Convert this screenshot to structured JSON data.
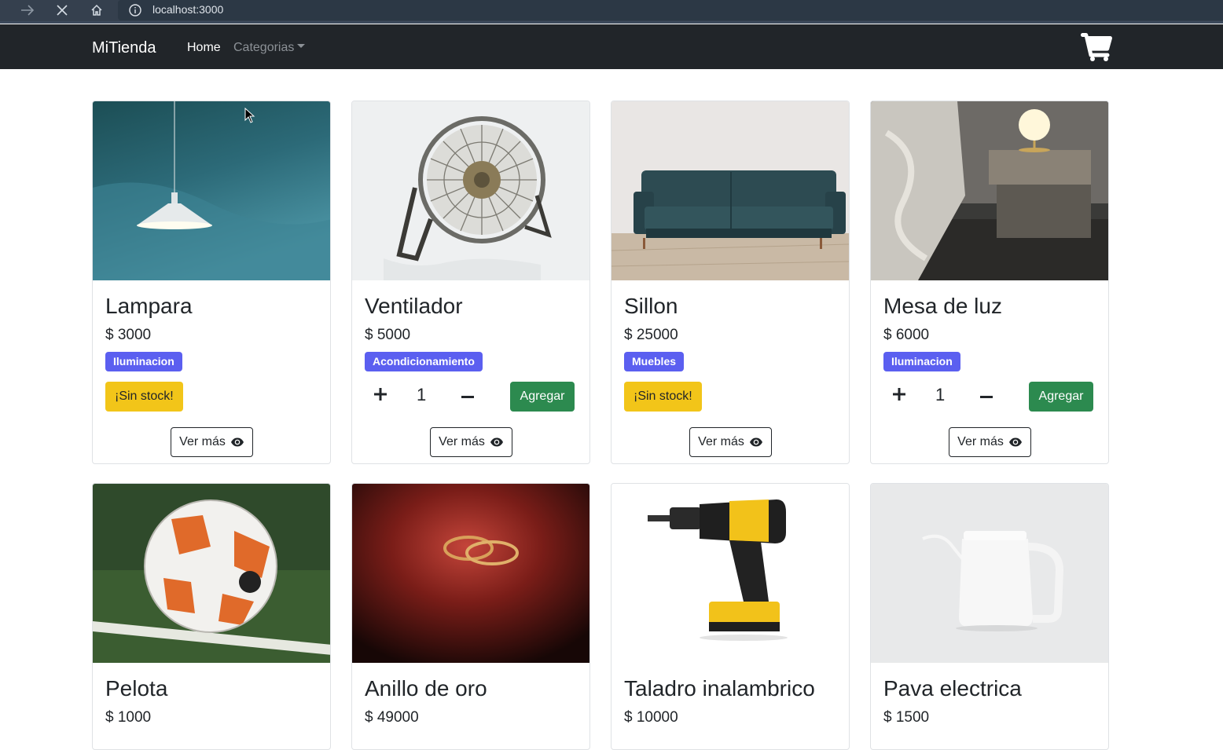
{
  "browser": {
    "url": "localhost:3000"
  },
  "navbar": {
    "brand": "MiTienda",
    "home": "Home",
    "categories": "Categorias"
  },
  "colors": {
    "navbar_bg": "#212529",
    "badge": "#5b5ff0",
    "sin_stock": "#f2c519",
    "agregar": "#2c8a4f"
  },
  "products": [
    {
      "name": "Lampara",
      "price": "$ 3000",
      "category": "Iluminacion",
      "in_stock": false,
      "stock_label": "¡Sin stock!",
      "image": "lamp-image",
      "view": "Ver más"
    },
    {
      "name": "Ventilador",
      "price": "$ 5000",
      "category": "Acondicionamiento",
      "in_stock": true,
      "quantity": "1",
      "add_label": "Agregar",
      "image": "fan-image",
      "view": "Ver más"
    },
    {
      "name": "Sillon",
      "price": "$ 25000",
      "category": "Muebles",
      "in_stock": false,
      "stock_label": "¡Sin stock!",
      "image": "sofa-image",
      "view": "Ver más"
    },
    {
      "name": "Mesa de luz",
      "price": "$ 6000",
      "category": "Iluminacion",
      "in_stock": true,
      "quantity": "1",
      "add_label": "Agregar",
      "image": "nightstand-image",
      "view": "Ver más"
    },
    {
      "name": "Pelota",
      "price": "$ 1000",
      "image": "ball-image"
    },
    {
      "name": "Anillo de oro",
      "price": "$ 49000",
      "image": "ring-image"
    },
    {
      "name": "Taladro inalambrico",
      "price": "$ 10000",
      "image": "drill-image"
    },
    {
      "name": "Pava electrica",
      "price": "$ 1500",
      "image": "kettle-image"
    }
  ]
}
